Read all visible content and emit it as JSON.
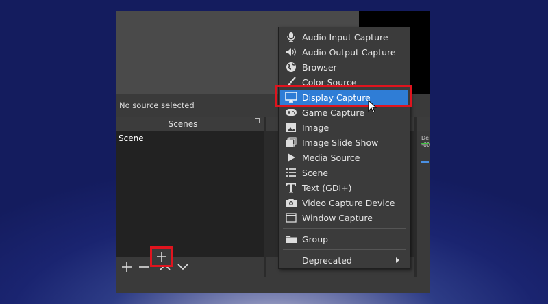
{
  "status": {
    "no_source": "No source selected"
  },
  "scenes": {
    "title": "Scenes",
    "items": [
      "Scene"
    ]
  },
  "mixer": {
    "label_top": "De",
    "label_db": "-60"
  },
  "menu": {
    "items": [
      {
        "label": "Audio Input Capture",
        "icon": "microphone-icon"
      },
      {
        "label": "Audio Output Capture",
        "icon": "speaker-icon"
      },
      {
        "label": "Browser",
        "icon": "globe-icon"
      },
      {
        "label": "Color Source",
        "icon": "paintbrush-icon"
      },
      {
        "label": "Display Capture",
        "icon": "monitor-icon",
        "active": true
      },
      {
        "label": "Game Capture",
        "icon": "gamepad-icon"
      },
      {
        "label": "Image",
        "icon": "image-icon"
      },
      {
        "label": "Image Slide Show",
        "icon": "slideshow-icon"
      },
      {
        "label": "Media Source",
        "icon": "play-icon"
      },
      {
        "label": "Scene",
        "icon": "list-icon"
      },
      {
        "label": "Text (GDI+)",
        "icon": "text-icon"
      },
      {
        "label": "Video Capture Device",
        "icon": "camera-icon"
      },
      {
        "label": "Window Capture",
        "icon": "window-icon"
      }
    ],
    "group": "Group",
    "deprecated": "Deprecated"
  },
  "colors": {
    "highlight": "#e0141e",
    "accent": "#2f7dd6"
  }
}
